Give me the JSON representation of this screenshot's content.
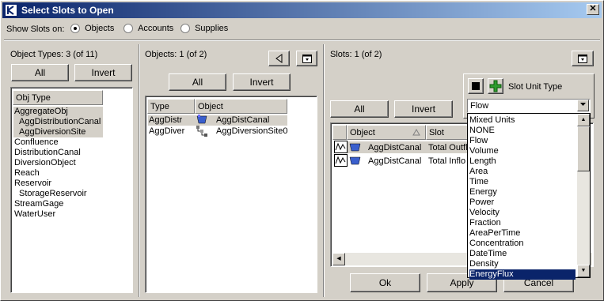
{
  "window": {
    "title": "Select Slots to Open",
    "close_glyph": "✕"
  },
  "show_slots": {
    "label": "Show Slots on:",
    "options": [
      "Objects",
      "Accounts",
      "Supplies"
    ],
    "selected": "Objects"
  },
  "object_types": {
    "header": "Object Types: 3 (of 11)",
    "all_label": "All",
    "invert_label": "Invert",
    "column": "Obj Type",
    "items": [
      "AggregateObj",
      "AggDistributionCanal",
      "AggDiversionSite",
      "Confluence",
      "DistributionCanal",
      "DiversionObject",
      "Reach",
      "Reservoir",
      "StorageReservoir",
      "StreamGage",
      "WaterUser"
    ]
  },
  "objects": {
    "header": "Objects: 1 (of 2)",
    "all_label": "All",
    "invert_label": "Invert",
    "columns": [
      "Type",
      "Object"
    ],
    "rows": [
      {
        "type": "AggDistr",
        "object": "AggDistCanal"
      },
      {
        "type": "AggDiver",
        "object": "AggDiversionSite0"
      }
    ]
  },
  "slots": {
    "header": "Slots: 1 (of 2)",
    "all_label": "All",
    "invert_label": "Invert",
    "columns": [
      "Object",
      "Slot"
    ],
    "rows": [
      {
        "object": "AggDistCanal",
        "slot": "Total Outfl"
      },
      {
        "object": "AggDistCanal",
        "slot": "Total Inflo"
      }
    ]
  },
  "slot_unit_type": {
    "label": "Slot Unit Type",
    "selected": "Flow",
    "options": [
      "Mixed Units",
      "NONE",
      "Flow",
      "Volume",
      "Length",
      "Area",
      "Time",
      "Energy",
      "Power",
      "Velocity",
      "Fraction",
      "AreaPerTime",
      "Concentration",
      "DateTime",
      "Density",
      "EnergyFlux"
    ],
    "highlighted": "EnergyFlux"
  },
  "footer": {
    "ok_label": "Ok",
    "apply_label": "Apply",
    "cancel_label": "Cancel"
  }
}
